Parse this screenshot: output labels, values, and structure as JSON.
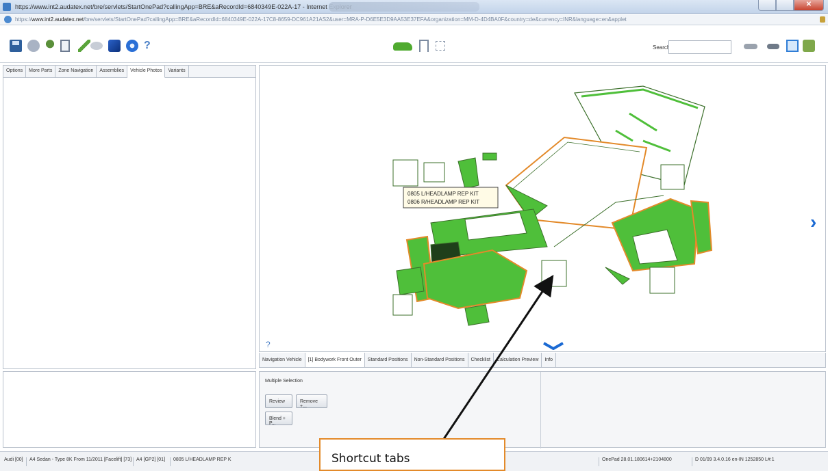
{
  "window": {
    "title": "https://www.int2.audatex.net/bre/servlets/StartOnePad?callingApp=BRE&aRecordId=6840349E-022A-17 - Internet Explorer",
    "address_prefix": "https://",
    "address_host": "www.int2.audatex.net",
    "address_rest": "/bre/servlets/StartOnePad?callingApp=BRE&aRecordId=6840349E-022A-17C8-8659-DC961A21AS2&user=MRA-P-D6E5E3D9AA53E37EFA&organization=MM-D-4D4BA0F&country=de&currency=INR&language=en&applet"
  },
  "toolbar": {
    "search_label": "Search:",
    "search_value": "",
    "icons": [
      "save-icon",
      "settings-icon",
      "tree-icon",
      "document-icon",
      "pen-icon",
      "eye-icon",
      "cube-icon",
      "compass-icon",
      "help-icon",
      "car-icon",
      "flag-icon",
      "grid-icon",
      "car-outline-icon",
      "car-dark-icon",
      "window-icon",
      "exit-icon"
    ]
  },
  "left_tabs": [
    {
      "label": "Options"
    },
    {
      "label": "More Parts"
    },
    {
      "label": "Zone Navigation"
    },
    {
      "label": "Assemblies"
    },
    {
      "label": "Vehicle Photos",
      "active": true
    },
    {
      "label": "Variants"
    }
  ],
  "diagram": {
    "tooltip_line1": "0805 L/HEADLAMP REP KIT",
    "tooltip_line2": "0806 R/HEADLAMP REP KIT",
    "colors": {
      "part_green": "#4fbf3a",
      "highlight_orange": "#e38a2a",
      "outline": "#3b6f2a",
      "nav_blue": "#1b6ad3"
    }
  },
  "bottom_tabs": [
    {
      "label": "Navigation Vehicle"
    },
    {
      "label": "[1] Bodywork Front Outer",
      "active": true
    },
    {
      "label": "Standard Positions"
    },
    {
      "label": "Non-Standard Positions"
    },
    {
      "label": "Checklist"
    },
    {
      "label": "Calculation Preview"
    },
    {
      "label": "Info"
    }
  ],
  "selection": {
    "title": "Multiple Selection",
    "review_label": "Review",
    "remove_label": "Remove +...",
    "blend_label": "Blend + P..."
  },
  "status": {
    "make": "Audi [00]",
    "model": "A4 Sedan - Type 8K From 11/2011 [Facelift] [73]",
    "variant": "A4 [GP2] [01]",
    "part": "0805 L/HEADLAMP REP K",
    "version": "OnePad 28.01.180614+2104800",
    "build": "D 01/09 3.4.0.16 en-IN 1252850 L#:1"
  },
  "callout": {
    "text": "Shortcut tabs"
  }
}
